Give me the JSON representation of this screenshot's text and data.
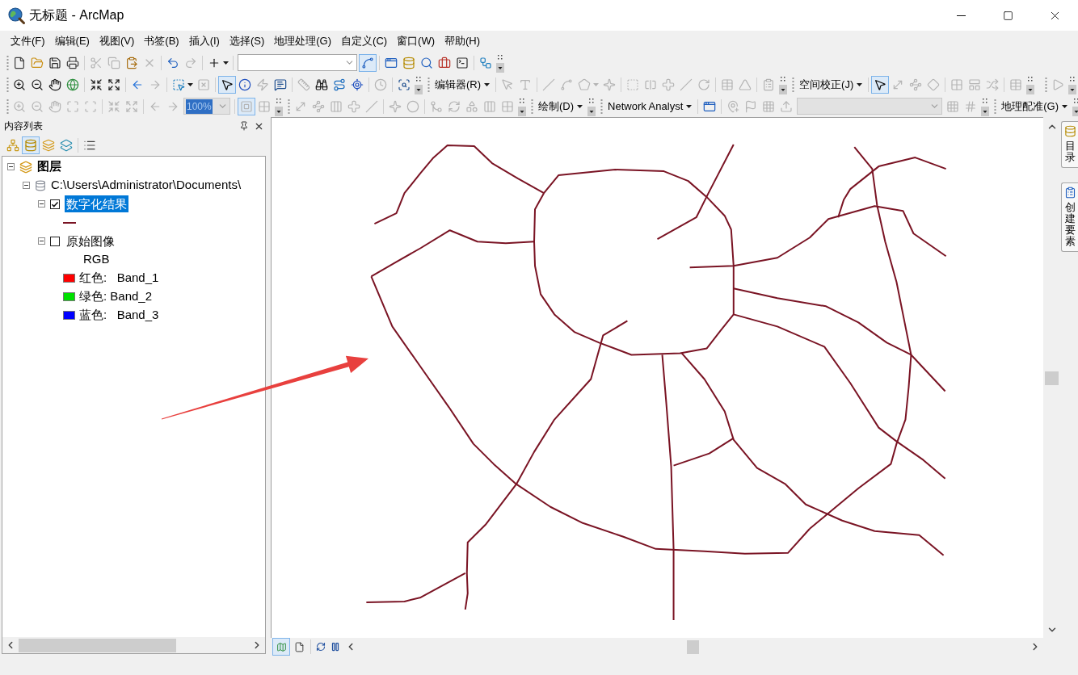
{
  "window": {
    "title": "无标题 - ArcMap"
  },
  "menu": [
    "文件(F)",
    "编辑(E)",
    "视图(V)",
    "书签(B)",
    "插入(I)",
    "选择(S)",
    "地理处理(G)",
    "自定义(C)",
    "窗口(W)",
    "帮助(H)"
  ],
  "toolbar_rows": [
    [
      {
        "groups": [
          [
            {
              "kind": "file",
              "disabled": false,
              "selected": false
            },
            {
              "kind": "folder",
              "disabled": false,
              "selected": false
            },
            {
              "kind": "save",
              "disabled": false,
              "selected": false
            },
            {
              "kind": "printer",
              "disabled": false,
              "selected": false
            }
          ],
          [
            {
              "kind": "scissors",
              "disabled": true,
              "selected": false
            },
            {
              "kind": "copy",
              "disabled": true,
              "selected": false
            },
            {
              "kind": "clipboard",
              "disabled": false,
              "selected": false
            },
            {
              "kind": "delete",
              "disabled": true,
              "selected": false
            }
          ],
          [
            {
              "kind": "undo",
              "disabled": false,
              "selected": false
            },
            {
              "kind": "redo",
              "disabled": true,
              "selected": false
            }
          ],
          [
            {
              "kind": "plus",
              "disabled": false,
              "selected": false
            },
            {
              "kind": "caret",
              "disabled": false
            }
          ],
          [
            {
              "kind": "combo",
              "disabled": false
            },
            {
              "kind": "spline",
              "disabled": false,
              "selected": true
            }
          ],
          [
            {
              "kind": "window",
              "disabled": false,
              "selected": false
            },
            {
              "kind": "database",
              "disabled": false,
              "selected": false
            },
            {
              "kind": "search",
              "disabled": false,
              "selected": false
            },
            {
              "kind": "briefcase",
              "disabled": false,
              "selected": false
            },
            {
              "kind": "terminal",
              "disabled": false,
              "selected": false
            }
          ],
          [
            {
              "kind": "workflow",
              "disabled": false,
              "selected": false
            }
          ]
        ]
      }
    ],
    [
      {
        "groups": [
          [
            {
              "kind": "zoom-in",
              "disabled": false,
              "selected": false
            },
            {
              "kind": "zoom-out",
              "disabled": false,
              "selected": false
            },
            {
              "kind": "hand",
              "disabled": false,
              "selected": false
            },
            {
              "kind": "globe",
              "disabled": false,
              "selected": false
            }
          ],
          [
            {
              "kind": "shrink",
              "disabled": false,
              "selected": false
            },
            {
              "kind": "expand-arrows",
              "disabled": false,
              "selected": false
            }
          ],
          [
            {
              "kind": "arrow-left",
              "disabled": false,
              "selected": false
            },
            {
              "kind": "arrow-right",
              "disabled": true,
              "selected": false
            }
          ],
          [
            {
              "kind": "select-pointer",
              "disabled": false,
              "selected": false
            },
            {
              "kind": "caret",
              "disabled": false
            },
            {
              "kind": "square-x",
              "disabled": true,
              "selected": false
            }
          ],
          [
            {
              "kind": "cursor",
              "disabled": false,
              "selected": true
            },
            {
              "kind": "info",
              "disabled": false,
              "selected": false
            },
            {
              "kind": "lightning",
              "disabled": true,
              "selected": false
            },
            {
              "kind": "message",
              "disabled": false,
              "selected": false
            }
          ],
          [
            {
              "kind": "ruler",
              "disabled": true,
              "selected": false
            },
            {
              "kind": "binoculars",
              "disabled": false,
              "selected": false
            },
            {
              "kind": "route",
              "disabled": false,
              "selected": false
            },
            {
              "kind": "locate",
              "disabled": false,
              "selected": false
            }
          ],
          [
            {
              "kind": "clock",
              "disabled": true,
              "selected": false
            }
          ],
          [
            {
              "kind": "scan-search",
              "disabled": false,
              "selected": false
            }
          ]
        ]
      },
      {
        "menu": "编辑器(R)",
        "groups": [
          [
            {
              "kind": "pointer",
              "disabled": true,
              "selected": false
            },
            {
              "kind": "text-tool",
              "disabled": true,
              "selected": false
            }
          ],
          [
            {
              "kind": "line",
              "disabled": true,
              "selected": false
            },
            {
              "kind": "curve",
              "disabled": true,
              "selected": false
            },
            {
              "kind": "polygon",
              "disabled": true,
              "selected": false
            },
            {
              "kind": "caret",
              "disabled": true
            },
            {
              "kind": "sparkle",
              "disabled": true,
              "selected": false
            }
          ],
          [
            {
              "kind": "dashed-square",
              "disabled": true,
              "selected": false
            },
            {
              "kind": "split",
              "disabled": true,
              "selected": false
            },
            {
              "kind": "cross",
              "disabled": true,
              "selected": false
            },
            {
              "kind": "line",
              "disabled": true,
              "selected": false
            },
            {
              "kind": "rotate",
              "disabled": true,
              "selected": false
            }
          ],
          [
            {
              "kind": "table",
              "disabled": true,
              "selected": false
            },
            {
              "kind": "triangle",
              "disabled": true,
              "selected": false
            }
          ],
          [
            {
              "kind": "form",
              "disabled": true,
              "selected": false
            }
          ]
        ]
      },
      {
        "menu": "空间校正(J)",
        "groups": [
          [
            {
              "kind": "cursor",
              "disabled": false,
              "selected": true
            },
            {
              "kind": "diagonal-arrow",
              "disabled": true,
              "selected": false
            },
            {
              "kind": "waypoints",
              "disabled": true,
              "selected": false
            },
            {
              "kind": "diamond",
              "disabled": true,
              "selected": false
            }
          ],
          [
            {
              "kind": "grid",
              "disabled": true,
              "selected": false
            },
            {
              "kind": "panel",
              "disabled": true,
              "selected": false
            },
            {
              "kind": "shuffle",
              "disabled": true,
              "selected": false
            }
          ],
          [
            {
              "kind": "table",
              "disabled": true,
              "selected": false
            }
          ]
        ]
      },
      {
        "groups": [
          [
            {
              "kind": "play",
              "disabled": true,
              "selected": false
            }
          ]
        ]
      }
    ],
    [
      {
        "groups": [
          [
            {
              "kind": "zoom-in",
              "disabled": true,
              "selected": false
            },
            {
              "kind": "zoom-out",
              "disabled": true,
              "selected": false
            },
            {
              "kind": "hand",
              "disabled": true,
              "selected": false
            },
            {
              "kind": "maximize",
              "disabled": true,
              "selected": false
            },
            {
              "kind": "frame",
              "disabled": true,
              "selected": false
            }
          ],
          [
            {
              "kind": "shrink",
              "disabled": true,
              "selected": false
            },
            {
              "kind": "expand-arrows",
              "disabled": true,
              "selected": false
            }
          ],
          [
            {
              "kind": "arrow-left",
              "disabled": true,
              "selected": false
            },
            {
              "kind": "arrow-right",
              "disabled": true,
              "selected": false
            },
            {
              "kind": "narrow-combo",
              "disabled": true,
              "highlighted": true,
              "value": "100%"
            }
          ],
          [
            {
              "kind": "nested-square",
              "disabled": true,
              "selected": true
            },
            {
              "kind": "grid",
              "disabled": true,
              "selected": false
            }
          ]
        ]
      },
      {
        "groups": [
          [
            {
              "kind": "diagonal-arrow",
              "disabled": true,
              "selected": false
            },
            {
              "kind": "waypoints",
              "disabled": true,
              "selected": false
            },
            {
              "kind": "columns",
              "disabled": true,
              "selected": false
            },
            {
              "kind": "cross",
              "disabled": true,
              "selected": false
            },
            {
              "kind": "line",
              "disabled": true,
              "selected": false
            }
          ],
          [
            {
              "kind": "sparkle",
              "disabled": true,
              "selected": false
            },
            {
              "kind": "circle",
              "disabled": true,
              "selected": false
            }
          ],
          [
            {
              "kind": "merge",
              "disabled": true,
              "selected": false
            },
            {
              "kind": "refresh",
              "disabled": true,
              "selected": false
            },
            {
              "kind": "shapes",
              "disabled": true,
              "selected": false
            },
            {
              "kind": "columns",
              "disabled": true,
              "selected": false
            },
            {
              "kind": "grid",
              "disabled": true,
              "selected": false
            }
          ]
        ]
      },
      {
        "menu": "绘制(D)"
      },
      {
        "menu": "Network Analyst",
        "groups": [
          [
            {
              "kind": "window",
              "disabled": false,
              "selected": false
            }
          ],
          [
            {
              "kind": "pin-plus",
              "disabled": true,
              "selected": false
            },
            {
              "kind": "flag",
              "disabled": true,
              "selected": false
            },
            {
              "kind": "dots-grid",
              "disabled": true,
              "selected": false
            },
            {
              "kind": "upload",
              "disabled": true,
              "selected": false
            },
            {
              "kind": "wide-combo",
              "disabled": true
            },
            {
              "kind": "dots-grid",
              "disabled": true,
              "selected": false
            },
            {
              "kind": "hash",
              "disabled": true,
              "selected": false
            }
          ]
        ]
      },
      {
        "menu": "地理配准(G)"
      }
    ]
  ],
  "toc": {
    "title": "内容列表",
    "tabs": [
      {
        "kind": "network",
        "selected": false
      },
      {
        "kind": "database",
        "selected": true
      },
      {
        "kind": "layers",
        "selected": false
      },
      {
        "kind": "stack",
        "selected": false
      }
    ],
    "tree": [
      {
        "kind": "data-frame",
        "label": "图层",
        "expanded": true,
        "children": [
          {
            "kind": "folder",
            "label": "C:\\Users\\Administrator\\Documents\\",
            "expanded": true,
            "children": [
              {
                "kind": "layer",
                "label": "数字化结果",
                "checked": true,
                "selected": true,
                "expanded": true,
                "legend": [
                  {
                    "kind": "line",
                    "color": "#7a1424"
                  }
                ]
              },
              {
                "kind": "layer",
                "label": "原始图像",
                "checked": false,
                "selected": false,
                "expanded": true,
                "legend": [
                  {
                    "kind": "heading",
                    "label": "RGB"
                  },
                  {
                    "kind": "swatch",
                    "label": "红色:   Band_1",
                    "color": "#ff0000"
                  },
                  {
                    "kind": "swatch",
                    "label": "绿色: Band_2",
                    "color": "#00e000"
                  },
                  {
                    "kind": "swatch",
                    "label": "蓝色:   Band_3",
                    "color": "#0000ff"
                  }
                ]
              }
            ]
          }
        ]
      }
    ]
  },
  "view_buttons": [
    {
      "kind": "map",
      "selected": true
    },
    {
      "kind": "file",
      "selected": false
    }
  ],
  "dock_tabs": [
    {
      "kind": "database",
      "label": "目录"
    },
    {
      "kind": "form",
      "label": "创建要素"
    }
  ]
}
